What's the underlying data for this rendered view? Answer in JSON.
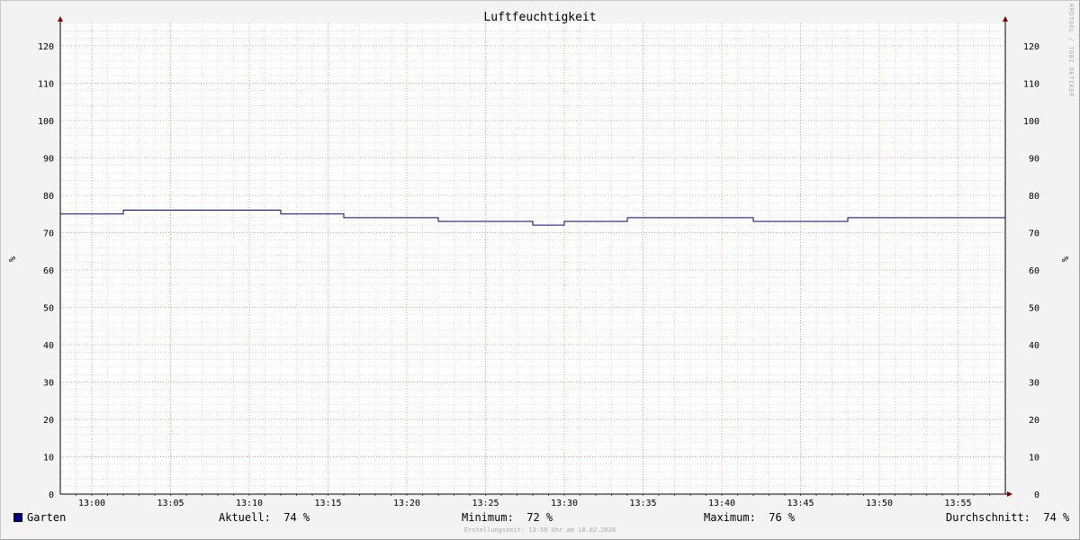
{
  "chart_data": {
    "type": "line",
    "title": "Luftfeuchtigkeit",
    "ylabel_left": "%",
    "ylabel_right": "%",
    "ylim": [
      0,
      126
    ],
    "y_ticks": [
      0,
      10,
      20,
      30,
      40,
      50,
      60,
      70,
      80,
      90,
      100,
      110,
      120
    ],
    "x_range_minutes": [
      "12:58",
      "13:58"
    ],
    "x_tick_labels": [
      "13:00",
      "13:05",
      "13:10",
      "13:15",
      "13:20",
      "13:25",
      "13:30",
      "13:35",
      "13:40",
      "13:45",
      "13:50",
      "13:55"
    ],
    "grid": true,
    "line_color": "#000080",
    "series": [
      {
        "name": "Garten",
        "color": "#000080",
        "x": [
          "12:58",
          "13:02",
          "13:12",
          "13:16",
          "13:22",
          "13:28",
          "13:30",
          "13:34",
          "13:42",
          "13:48",
          "13:58"
        ],
        "y": [
          75,
          76,
          75,
          74,
          73,
          72,
          73,
          74,
          73,
          74,
          74
        ]
      }
    ]
  },
  "legend": {
    "series_label": "Garten",
    "swatch_color": "#000080",
    "current": "Aktuell:  74 %",
    "minimum": "Minimum:  72 %",
    "maximum": "Maximum:  76 %",
    "average": "Durchschnitt:  74 %"
  },
  "footer": {
    "created": "Erstellungszeit: 13:58 Uhr am 18.02.2026",
    "watermark": "RRDTOOL / TOBI OETIKER"
  }
}
